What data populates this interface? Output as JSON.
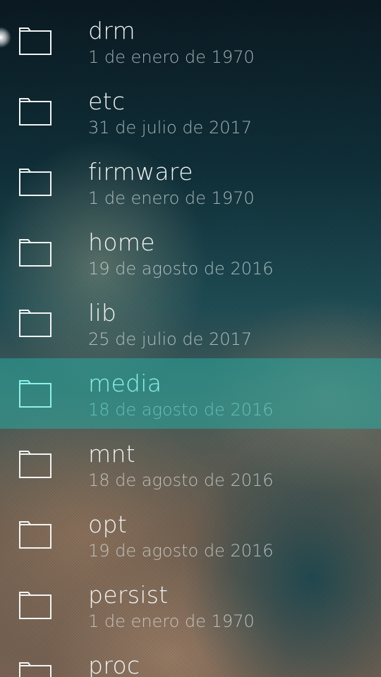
{
  "accent_color": "#2aa9a0",
  "folder_icon": "folder-icon",
  "files": [
    {
      "name": "drm",
      "date": "1 de enero de 1970",
      "selected": false
    },
    {
      "name": "etc",
      "date": "31 de julio de 2017",
      "selected": false
    },
    {
      "name": "firmware",
      "date": "1 de enero de 1970",
      "selected": false
    },
    {
      "name": "home",
      "date": "19 de agosto de 2016",
      "selected": false
    },
    {
      "name": "lib",
      "date": "25 de julio de 2017",
      "selected": false
    },
    {
      "name": "media",
      "date": "18 de agosto de 2016",
      "selected": true
    },
    {
      "name": "mnt",
      "date": "18 de agosto de 2016",
      "selected": false
    },
    {
      "name": "opt",
      "date": "19 de agosto de 2016",
      "selected": false
    },
    {
      "name": "persist",
      "date": "1 de enero de 1970",
      "selected": false
    },
    {
      "name": "proc",
      "date": "",
      "selected": false
    }
  ]
}
